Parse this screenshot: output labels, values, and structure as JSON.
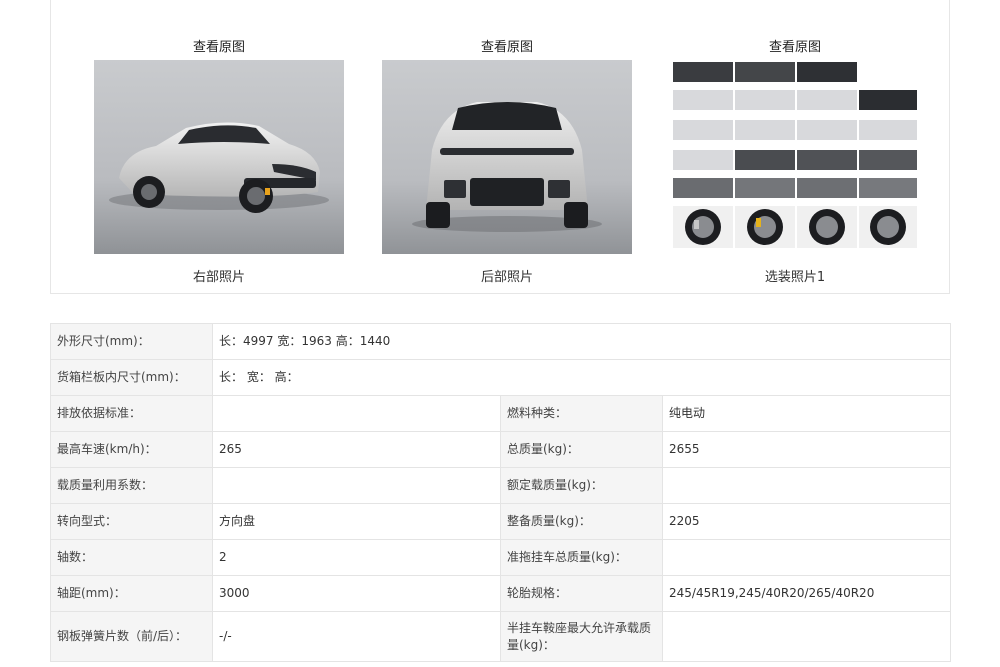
{
  "gallery": {
    "photos": [
      {
        "view_label": "查看原图",
        "caption": "右部照片",
        "icon": "car-front-right-view"
      },
      {
        "view_label": "查看原图",
        "caption": "后部照片",
        "icon": "car-rear-view"
      },
      {
        "view_label": "查看原图",
        "caption": "选装照片1",
        "icon": "optional-parts-collage"
      }
    ]
  },
  "specs": {
    "rows": [
      {
        "cells": [
          {
            "label": "外形尺寸(mm)：",
            "value": "长：4997 宽：1963 高：1440"
          }
        ]
      },
      {
        "cells": [
          {
            "label": "货箱栏板内尺寸(mm)：",
            "value": "长：  宽：  高："
          }
        ]
      },
      {
        "cells": [
          {
            "label": "排放依据标准：",
            "value": ""
          },
          {
            "label": "燃料种类：",
            "value": "纯电动"
          }
        ]
      },
      {
        "cells": [
          {
            "label": "最高车速(km/h)：",
            "value": "265"
          },
          {
            "label": "总质量(kg)：",
            "value": "2655"
          }
        ]
      },
      {
        "cells": [
          {
            "label": "载质量利用系数：",
            "value": ""
          },
          {
            "label": "额定载质量(kg)：",
            "value": ""
          }
        ]
      },
      {
        "cells": [
          {
            "label": "转向型式：",
            "value": "方向盘"
          },
          {
            "label": "整备质量(kg)：",
            "value": "2205"
          }
        ]
      },
      {
        "cells": [
          {
            "label": "轴数：",
            "value": "2"
          },
          {
            "label": "准拖挂车总质量(kg)：",
            "value": ""
          }
        ]
      },
      {
        "cells": [
          {
            "label": "轴距(mm)：",
            "value": "3000"
          },
          {
            "label": "轮胎规格：",
            "value": "245/45R19,245/40R20/265/40R20"
          }
        ]
      },
      {
        "cells": [
          {
            "label": "钢板弹簧片数（前/后）：",
            "value": "-/-"
          },
          {
            "label": "半挂车鞍座最大允许承载质量(kg)：",
            "value": ""
          }
        ]
      }
    ]
  }
}
